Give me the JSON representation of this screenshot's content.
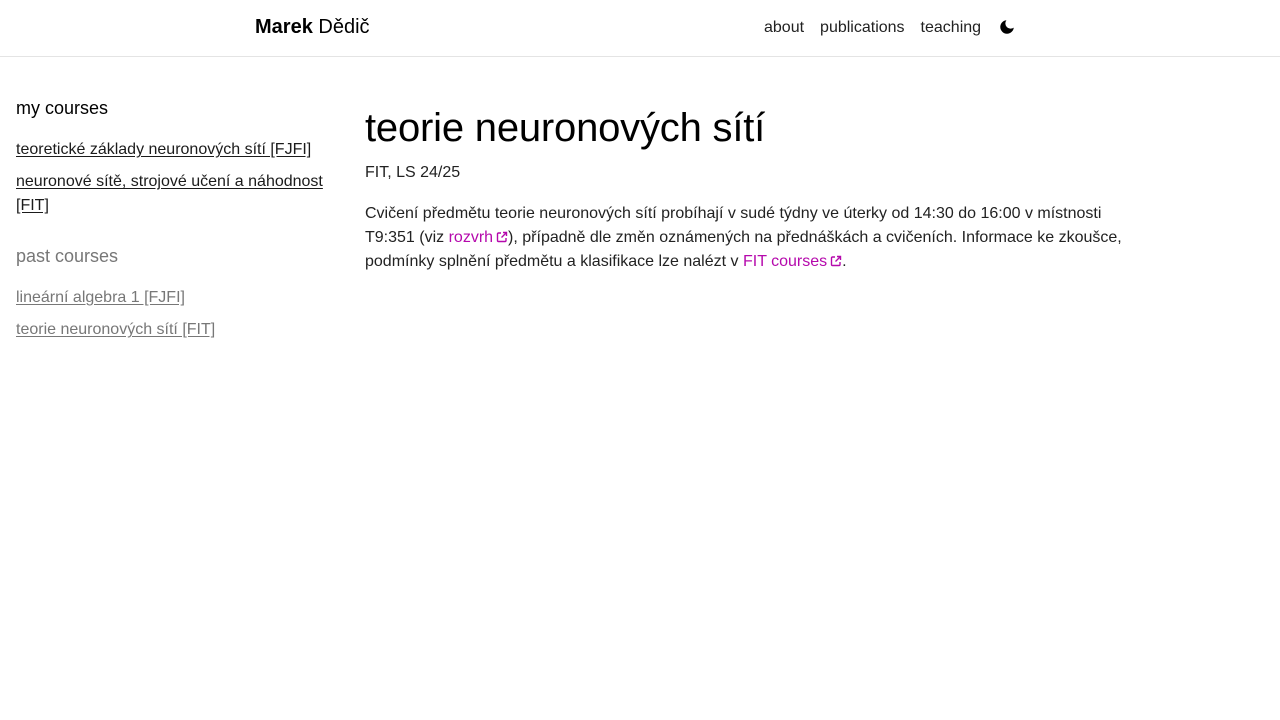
{
  "header": {
    "brand_first": "Marek",
    "brand_last": "Dědič",
    "nav": [
      {
        "label": "about"
      },
      {
        "label": "publications"
      },
      {
        "label": "teaching"
      }
    ],
    "theme_icon": "moon-icon"
  },
  "sidebar": {
    "my_courses_heading": "my courses",
    "my_courses": [
      {
        "label": "teoretické základy neuronových sítí [FJFI]"
      },
      {
        "label": "neuronové sítě, strojové učení a náhodnost [FIT]"
      }
    ],
    "past_courses_heading": "past courses",
    "past_courses": [
      {
        "label": "lineární algebra 1 [FJFI]"
      },
      {
        "label": "teorie neuronových sítí [FIT]"
      }
    ]
  },
  "main": {
    "title": "teorie neuronových sítí",
    "subtitle": "FIT, LS 24/25",
    "desc_part1": "Cvičení předmětu teorie neuronových sítí probíhají v sudé týdny ve úterky od 14:30 do 16:00 v místnosti T9:351 (viz ",
    "link_rozvrh": "rozvrh",
    "desc_part2": "), případně dle změn oznámených na přednáškách a cvičeních. Informace ke zkoušce, podmínky splnění předmětu a klasifikace lze nalézt v ",
    "link_fit": "FIT courses",
    "desc_part3": ".",
    "link_color": "#b509ac"
  }
}
